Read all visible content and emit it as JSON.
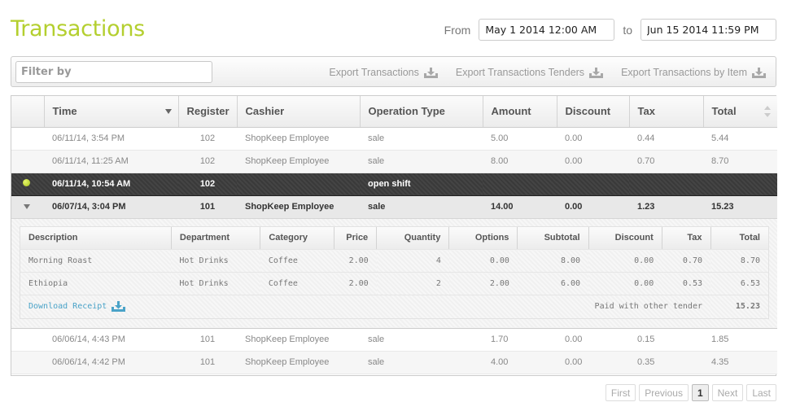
{
  "header": {
    "title": "Transactions",
    "from_label": "From",
    "to_label": "to",
    "from_value": "May 1 2014 12:00 AM",
    "to_value": "Jun 15 2014 11:59 PM"
  },
  "toolbar": {
    "filter_placeholder": "Filter by",
    "filter_value": "",
    "exports": [
      {
        "label": "Export Transactions",
        "icon": "download-tray-icon"
      },
      {
        "label": "Export Transactions Tenders",
        "icon": "download-tray-icon"
      },
      {
        "label": "Export Transactions by Item",
        "icon": "download-tray-icon"
      }
    ]
  },
  "table": {
    "columns": [
      "",
      "Time",
      "Register",
      "Cashier",
      "Operation Type",
      "Amount",
      "Discount",
      "Tax",
      "Total"
    ],
    "sorted_column": "Time",
    "sort_direction": "descending",
    "rows": [
      {
        "time": "06/11/14, 3:54 PM",
        "register": "102",
        "cashier": "ShopKeep Employee",
        "type": "sale",
        "amount": "5.00",
        "discount": "0.00",
        "tax": "0.44",
        "total": "5.44"
      },
      {
        "time": "06/11/14, 11:25 AM",
        "register": "102",
        "cashier": "ShopKeep Employee",
        "type": "sale",
        "amount": "8.00",
        "discount": "0.00",
        "tax": "0.70",
        "total": "8.70"
      },
      {
        "time": "06/11/14, 10:54 AM",
        "register": "102",
        "cashier": "",
        "type": "open shift",
        "amount": "",
        "discount": "",
        "tax": "",
        "total": "",
        "status": "active-shift-dot"
      },
      {
        "time": "06/07/14, 3:04 PM",
        "register": "101",
        "cashier": "ShopKeep Employee",
        "type": "sale",
        "amount": "14.00",
        "discount": "0.00",
        "tax": "1.23",
        "total": "15.23",
        "expanded": true
      },
      {
        "time": "06/06/14, 4:43 PM",
        "register": "101",
        "cashier": "ShopKeep Employee",
        "type": "sale",
        "amount": "1.70",
        "discount": "0.00",
        "tax": "0.15",
        "total": "1.85"
      },
      {
        "time": "06/06/14, 4:42 PM",
        "register": "101",
        "cashier": "ShopKeep Employee",
        "type": "sale",
        "amount": "4.00",
        "discount": "0.00",
        "tax": "0.35",
        "total": "4.35"
      }
    ]
  },
  "detail": {
    "columns": [
      "Description",
      "Department",
      "Category",
      "Price",
      "Quantity",
      "Options",
      "Subtotal",
      "Discount",
      "Tax",
      "Total"
    ],
    "items": [
      {
        "description": "Morning Roast",
        "department": "Hot Drinks",
        "category": "Coffee",
        "price": "2.00",
        "quantity": "4",
        "options": "0.00",
        "subtotal": "8.00",
        "discount": "0.00",
        "tax": "0.70",
        "total": "8.70"
      },
      {
        "description": "Ethiopia",
        "department": "Hot Drinks",
        "category": "Coffee",
        "price": "2.00",
        "quantity": "2",
        "options": "2.00",
        "subtotal": "6.00",
        "discount": "0.00",
        "tax": "0.53",
        "total": "6.53"
      }
    ],
    "download_label": "Download Receipt",
    "tender_label": "Paid with other tender",
    "tender_total": "15.23"
  },
  "pagination": {
    "first": "First",
    "previous": "Previous",
    "current": "1",
    "next": "Next",
    "last": "Last"
  },
  "colors": {
    "title_green": "#b4cf2f",
    "link_blue": "#4aa3c8",
    "shift_dot": "#b8d429"
  }
}
